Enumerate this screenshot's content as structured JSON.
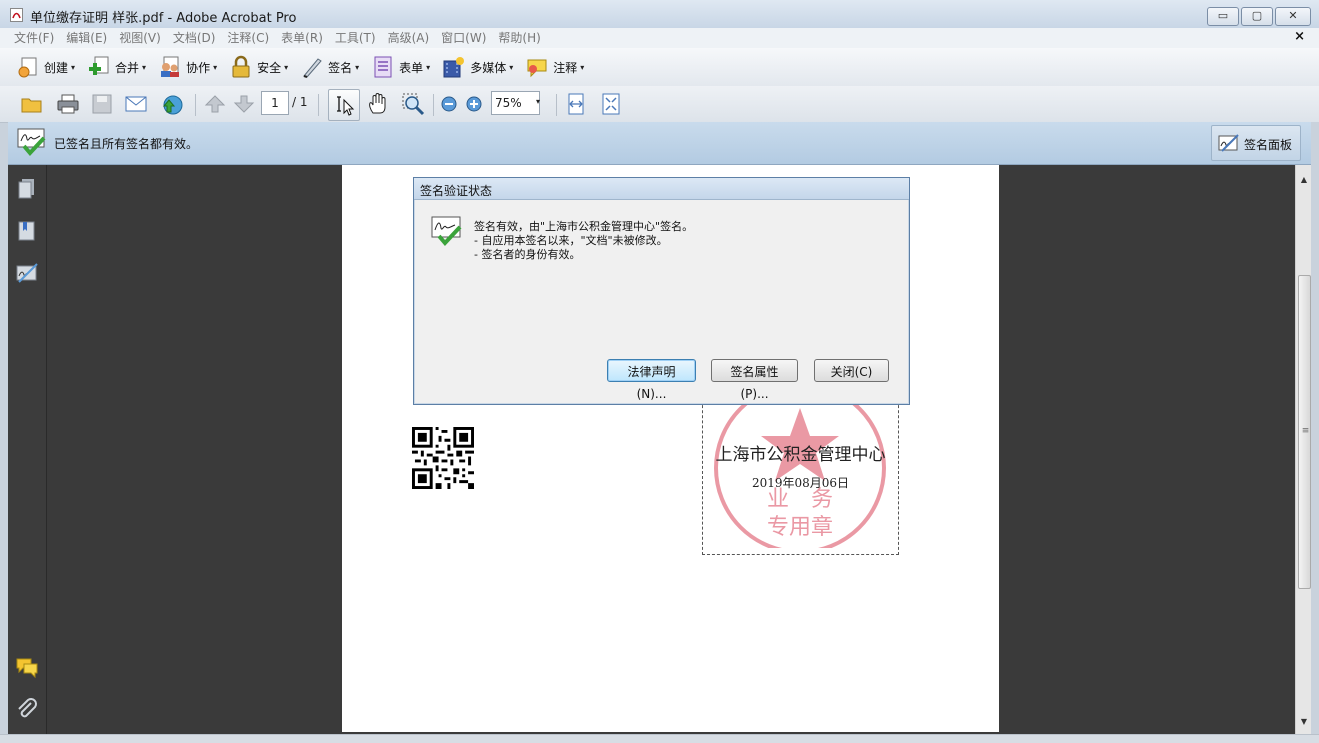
{
  "window": {
    "title": "单位缴存证明 样张.pdf - Adobe Acrobat Pro",
    "buttons": {
      "minimize": "▭",
      "maximize": "▢",
      "close": "✕"
    },
    "doc_close": "×"
  },
  "menu": {
    "items": [
      "文件(F)",
      "编辑(E)",
      "视图(V)",
      "文档(D)",
      "注释(C)",
      "表单(R)",
      "工具(T)",
      "高级(A)",
      "窗口(W)",
      "帮助(H)"
    ]
  },
  "tasks": {
    "items": [
      {
        "label": "创建",
        "icon": "create-icon"
      },
      {
        "label": "合并",
        "icon": "combine-icon"
      },
      {
        "label": "协作",
        "icon": "collaborate-icon"
      },
      {
        "label": "安全",
        "icon": "lock-icon"
      },
      {
        "label": "签名",
        "icon": "pen-icon"
      },
      {
        "label": "表单",
        "icon": "form-icon"
      },
      {
        "label": "多媒体",
        "icon": "multimedia-icon"
      },
      {
        "label": "注释",
        "icon": "comment-icon"
      }
    ],
    "caret": "▾"
  },
  "nav": {
    "page_current": "1",
    "page_total": "/ 1",
    "zoom": "75%",
    "zoom_caret": "▾"
  },
  "signature_bar": {
    "message": "已签名且所有签名都有效。",
    "panel_button": "签名面板"
  },
  "document": {
    "stamp_line1": "上海市公积金管理中心",
    "stamp_line2": "2019年08月06日",
    "stamp_seal_text": "上海市公积金管理中心 业务专用章"
  },
  "scrollbar": {
    "up": "▲",
    "down": "▼",
    "grip": "≡"
  },
  "dialog": {
    "title": "签名验证状态",
    "line1": "签名有效，由\"上海市公积金管理中心\"签名。",
    "line2": "- 自应用本签名以来，\"文档\"未被修改。",
    "line3": "- 签名者的身份有效。",
    "buttons": {
      "legal": "法律声明(N)...",
      "properties": "签名属性(P)...",
      "close": "关闭(C)"
    }
  },
  "colors": {
    "accent": "#3c7fb1",
    "seal_red": "#d9455a",
    "valid_green": "#3ba33b"
  }
}
